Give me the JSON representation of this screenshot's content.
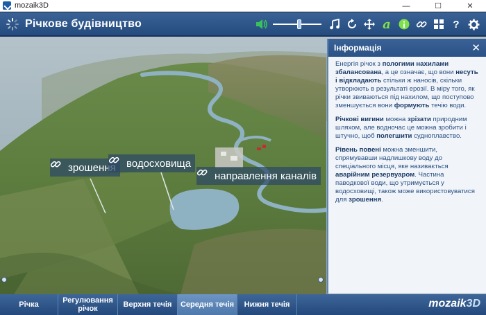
{
  "window": {
    "title": "mozaik3D",
    "minimize": "—",
    "maximize": "☐",
    "close": "✕"
  },
  "header": {
    "title": "Річкове будівництво",
    "volume_level": 0.55
  },
  "scene": {
    "labels": {
      "irrigation": "зрошення",
      "reservoir": "водосховища",
      "channel": "направлення каналів"
    }
  },
  "info": {
    "title": "Інформація",
    "close": "✕",
    "p1": [
      {
        "t": "Енергія річок з "
      },
      {
        "b": "пологими нахилами збалансована"
      },
      {
        "t": ", а це означає, що вони "
      },
      {
        "b": "несуть і відкладають"
      },
      {
        "t": " стільки ж наносів, скільки утворюють в результаті ерозії. В міру того, як річки звиваються під нахилом, що поступово зменшується вони "
      },
      {
        "b": "формують"
      },
      {
        "t": " течію води."
      }
    ],
    "p2": [
      {
        "b": "Річкові вигини"
      },
      {
        "t": " можна "
      },
      {
        "b": "зрізати"
      },
      {
        "t": " природним шляхом, але водночас це можна зробити і штучно, щоб "
      },
      {
        "b": "полегшити"
      },
      {
        "t": " судноплавство."
      }
    ],
    "p3": [
      {
        "b": "Рівень повені"
      },
      {
        "t": " можна зменшити, спрямувавши надлишкову воду до спеціального місця, яке називається "
      },
      {
        "b": "аварійним резервуаром"
      },
      {
        "t": ". Частина паводкової води, що утримується у водосховищі, також може використовуватися для "
      },
      {
        "b": "зрошення"
      },
      {
        "t": "."
      }
    ]
  },
  "nav": {
    "tab1": "Річка",
    "tab2": "Регулювання річок",
    "tab3": "Верхня течія",
    "tab4": "Середня течія",
    "tab5": "Нижня течія"
  },
  "brand": {
    "main": "mozaik",
    "suffix": "3D"
  },
  "colors": {
    "accent": "#2a5286",
    "active_tab": "#5f87b8",
    "volume_icon": "#39c25b",
    "tool_icon_green": "#7fe04b"
  }
}
